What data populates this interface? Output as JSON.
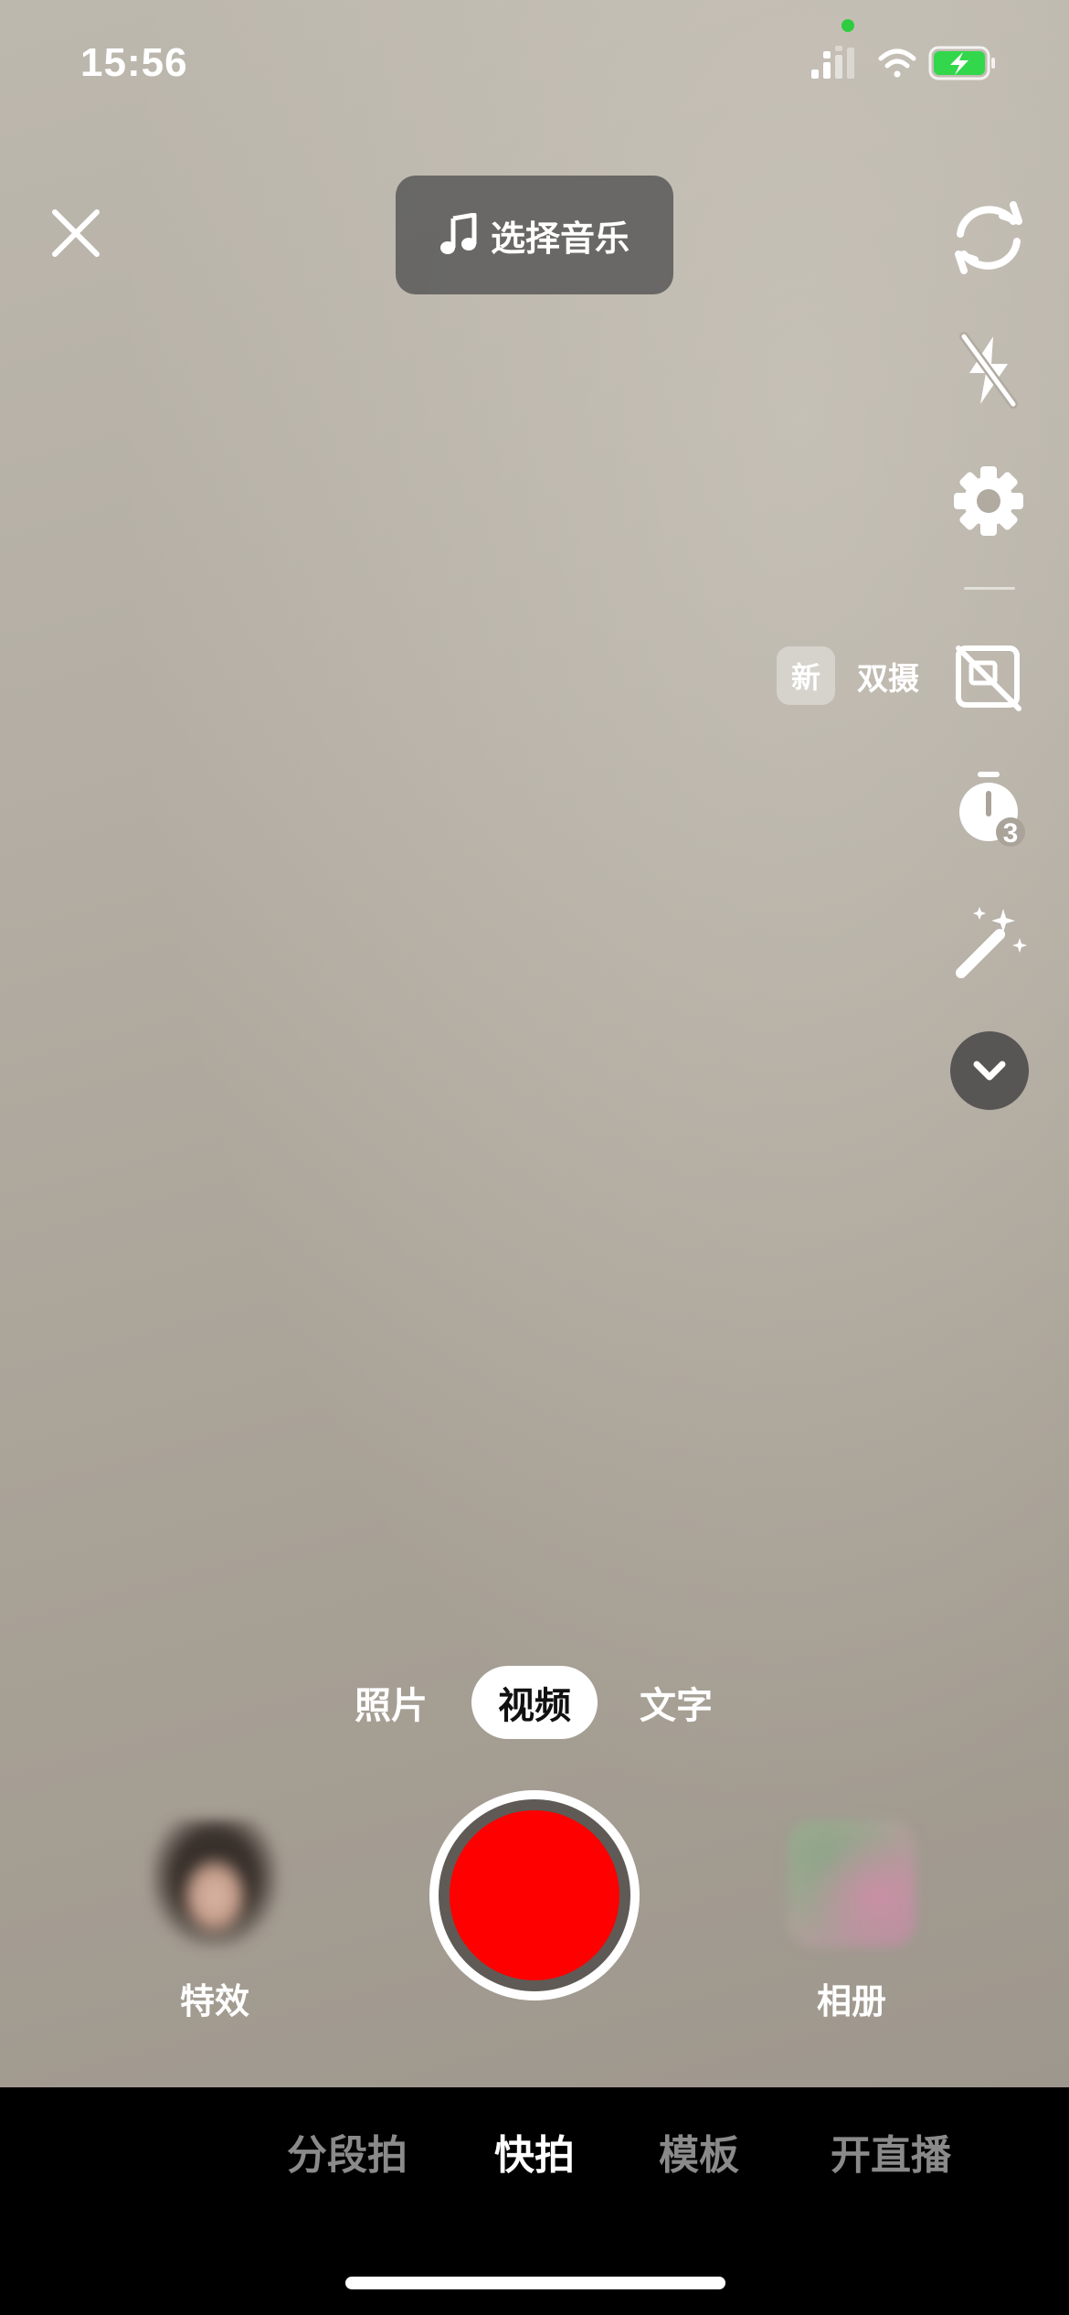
{
  "status_bar": {
    "time": "15:56",
    "icons": [
      "cellular-signal-icon",
      "wifi-icon",
      "battery-charging-icon"
    ],
    "camera_indicator_color": "#2ecc40"
  },
  "top_bar": {
    "close_icon": "close-icon",
    "music_button": {
      "icon": "music-note-icon",
      "label": "选择音乐"
    }
  },
  "right_toolbar": {
    "items": [
      {
        "name": "flip-camera",
        "icon": "flip-camera-icon"
      },
      {
        "name": "flash-off",
        "icon": "flash-off-icon"
      },
      {
        "name": "settings",
        "icon": "gear-icon"
      },
      {
        "name": "dual-camera",
        "icon": "dual-camera-off-icon",
        "badge": "新",
        "label": "双摄"
      },
      {
        "name": "timer",
        "icon": "timer-icon",
        "value": "3"
      },
      {
        "name": "beauty",
        "icon": "magic-wand-icon"
      },
      {
        "name": "more",
        "icon": "chevron-down-icon"
      }
    ]
  },
  "modes": {
    "items": [
      "照片",
      "视频",
      "文字"
    ],
    "selected": "视频"
  },
  "capture": {
    "effects_label": "特效",
    "album_label": "相册",
    "record_color": "#ff0000"
  },
  "bottom_tabs": {
    "items": [
      "分段拍",
      "快拍",
      "模板",
      "开直播"
    ],
    "selected": "快拍"
  }
}
